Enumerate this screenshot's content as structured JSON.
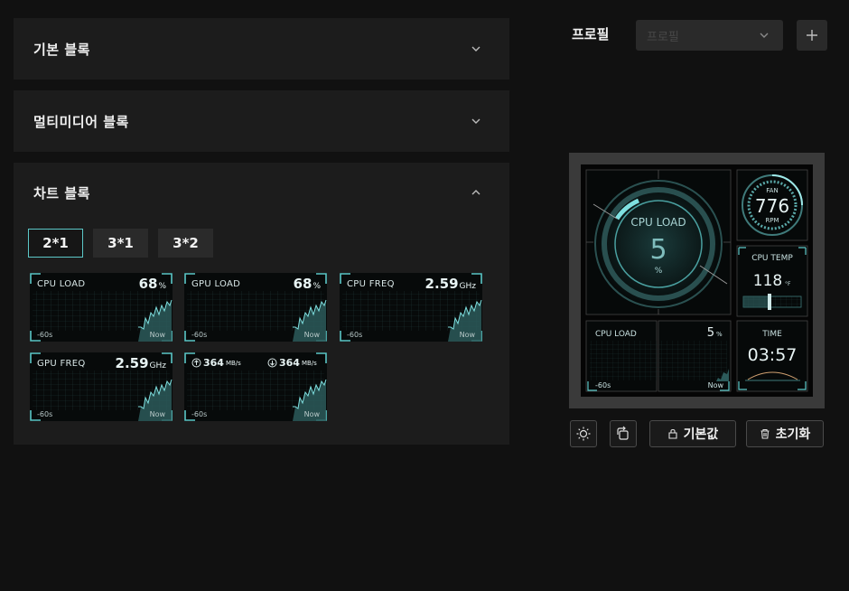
{
  "sections": {
    "basic": {
      "title": "기본 블록"
    },
    "multimedia": {
      "title": "멀티미디어 블록"
    },
    "chart": {
      "title": "차트 블록",
      "sizes": [
        "2*1",
        "3*1",
        "3*2"
      ],
      "tiles": [
        {
          "label": "CPU LOAD",
          "value": "68",
          "unit": "%",
          "x_start": "-60s",
          "x_end": "Now"
        },
        {
          "label": "GPU LOAD",
          "value": "68",
          "unit": "%",
          "x_start": "-60s",
          "x_end": "Now"
        },
        {
          "label": "CPU FREQ",
          "value": "2.59",
          "unit": "GHz",
          "x_start": "-60s",
          "x_end": "Now"
        },
        {
          "label": "GPU FREQ",
          "value": "2.59",
          "unit": "GHz",
          "x_start": "-60s",
          "x_end": "Now"
        },
        {
          "upload": "364",
          "download": "364",
          "unit": "MB/s",
          "x_start": "-60s",
          "x_end": "Now"
        }
      ]
    }
  },
  "profile": {
    "label": "프로필",
    "placeholder": "프로필",
    "add_icon": "plus-icon"
  },
  "preview": {
    "cpu_load_big": {
      "label": "CPU LOAD",
      "value": "5",
      "unit": "%"
    },
    "fan": {
      "label": "FAN",
      "value": "776",
      "unit": "RPM"
    },
    "cpu_temp": {
      "label": "CPU TEMP",
      "value": "118",
      "unit": "°F"
    },
    "cpu_load_chart": {
      "label": "CPU LOAD",
      "value": "5",
      "unit": "%",
      "x_start": "-60s",
      "x_end": "Now"
    },
    "time": {
      "label": "TIME",
      "value": "03:57"
    }
  },
  "actions": {
    "brightness_icon": "sun-icon",
    "rotate_icon": "rotate-icon",
    "default_label": "기본값",
    "reset_label": "초기화"
  },
  "colors": {
    "accent": "#5cc8c8",
    "panel": "#1c1c1c",
    "background": "#111111"
  }
}
